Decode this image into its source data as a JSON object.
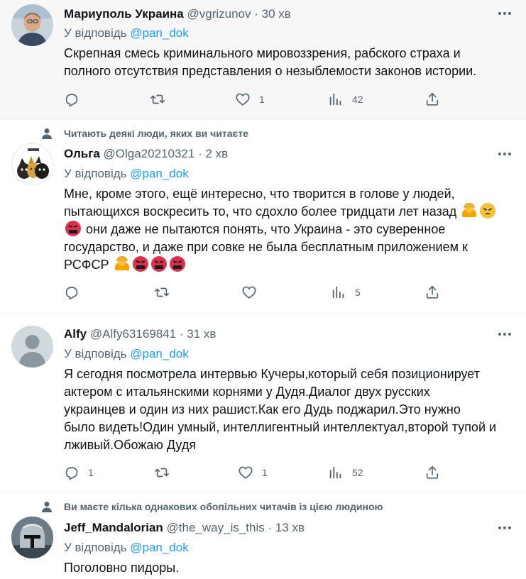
{
  "colors": {
    "accent": "#1d9bf0",
    "secondary_text": "#536471",
    "highlight_bg": "#f7f7f7"
  },
  "reply_prefix": "У відповідь",
  "tweets": [
    {
      "name": "Мариуполь Украина",
      "handle": "@vgrizunov",
      "separator": "·",
      "time": "30 хв",
      "reply_to": "@pan_dok",
      "lines": [
        "Скрепная смесь криминального мировоззрения, рабского страха и",
        "полного отсутствия представления о незыблемости законов истории."
      ],
      "replies": "",
      "retweets": "",
      "likes": "1",
      "views": "42"
    },
    {
      "social_context": "Читають деякі люди, яких ви читаєте",
      "name": "Ольга",
      "handle": "@Olga20210321",
      "separator": "·",
      "time": "2 хв",
      "reply_to": "@pan_dok",
      "lines": [
        "Мне, кроме этого, ещё интересно, что творится в голове у людей,",
        "пытающихся воскресить то, что сдохло более тридцати лет назад",
        "они даже не пытаются понять, что Украина - это суверенное",
        "государство, и даже при совке не была бесплатным приложением к",
        "РСФСР"
      ],
      "replies": "",
      "retweets": "",
      "likes": "",
      "views": "5"
    },
    {
      "name": "Alfy",
      "handle": "@Alfy63169841",
      "separator": "·",
      "time": "31 хв",
      "reply_to": "@pan_dok",
      "lines": [
        "Я сегодня посмотрела интервью Кучеры,который себя позиционирует",
        "актером с итальянскими корнями у Дудя.Диалог двух русских",
        "украинцев и один из них рашист.Как его Дудь поджарил.Это нужно",
        "было видеть!Один умный, интеллигентный интеллектуал,второй тупой и",
        "лживый.Обожаю Дудя"
      ],
      "replies": "1",
      "retweets": "",
      "likes": "1",
      "views": "52"
    },
    {
      "social_context": "Ви маєте кілька однакових обопільних читачів із цією людиною",
      "name": "Jeff_Mandalorian",
      "handle": "@the_way_is_this",
      "separator": "·",
      "time": "13 хв",
      "reply_to": "@pan_dok",
      "lines": [
        "Поголовно пидоры."
      ]
    }
  ]
}
